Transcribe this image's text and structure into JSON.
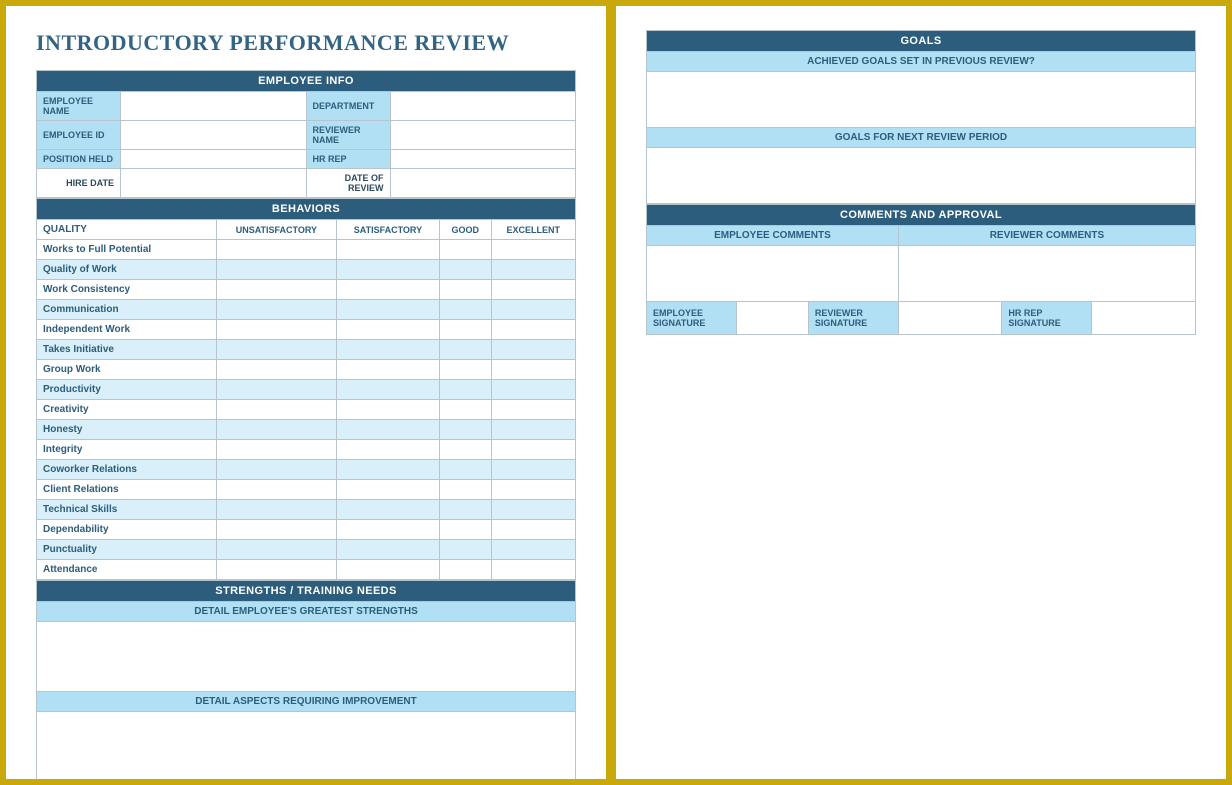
{
  "title": "INTRODUCTORY PERFORMANCE REVIEW",
  "sections": {
    "employee_info": {
      "header": "EMPLOYEE INFO",
      "labels": {
        "employee_name": "EMPLOYEE NAME",
        "department": "DEPARTMENT",
        "employee_id": "EMPLOYEE ID",
        "reviewer_name": "REVIEWER NAME",
        "position_held": "POSITION HELD",
        "hr_rep": "HR REP",
        "hire_date": "HIRE DATE",
        "date_of_review": "DATE OF REVIEW"
      }
    },
    "behaviors": {
      "header": "BEHAVIORS",
      "quality_label": "QUALITY",
      "cols": [
        "UNSATISFACTORY",
        "SATISFACTORY",
        "GOOD",
        "EXCELLENT"
      ],
      "rows": [
        "Works to Full Potential",
        "Quality of Work",
        "Work Consistency",
        "Communication",
        "Independent Work",
        "Takes Initiative",
        "Group Work",
        "Productivity",
        "Creativity",
        "Honesty",
        "Integrity",
        "Coworker Relations",
        "Client Relations",
        "Technical Skills",
        "Dependability",
        "Punctuality",
        "Attendance"
      ]
    },
    "strengths": {
      "header": "STRENGTHS / TRAINING NEEDS",
      "sub1": "DETAIL EMPLOYEE'S GREATEST STRENGTHS",
      "sub2": "DETAIL ASPECTS REQUIRING IMPROVEMENT"
    },
    "goals": {
      "header": "GOALS",
      "achieved": "ACHIEVED GOALS SET IN PREVIOUS REVIEW?",
      "next": "GOALS FOR NEXT REVIEW PERIOD"
    },
    "comments": {
      "header": "COMMENTS AND APPROVAL",
      "employee": "EMPLOYEE COMMENTS",
      "reviewer": "REVIEWER COMMENTS",
      "emp_sig": "EMPLOYEE SIGNATURE",
      "rev_sig": "REVIEWER SIGNATURE",
      "hr_sig": "HR REP SIGNATURE"
    }
  },
  "footer_faint": ""
}
